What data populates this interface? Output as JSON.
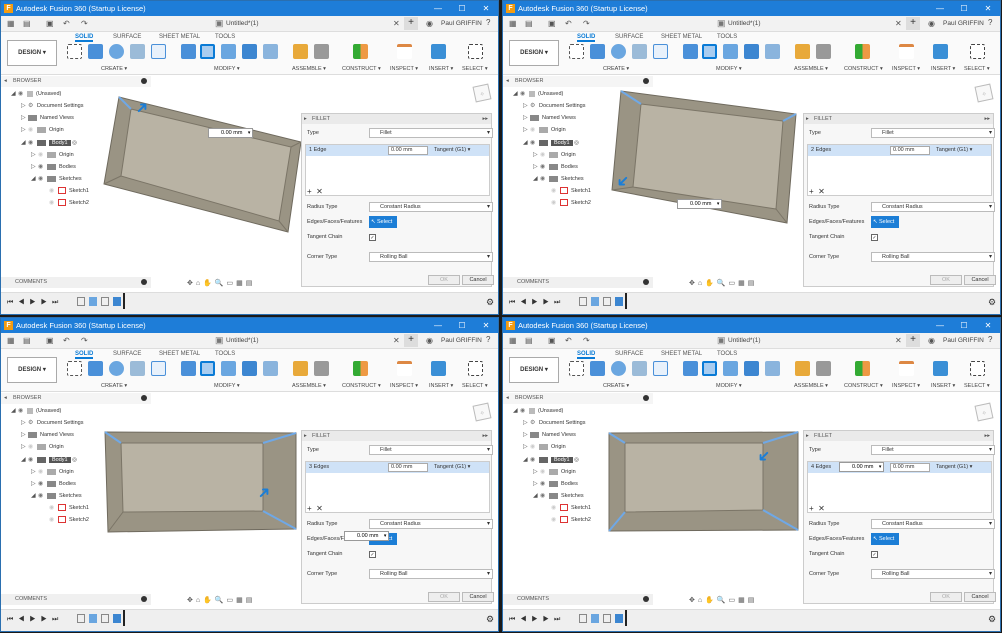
{
  "common": {
    "window_title": "Autodesk Fusion 360 (Startup License)",
    "doc_title": "Untitled*(1)",
    "user": "Paul GRIFFIN",
    "workspace": "DESIGN",
    "tabs": [
      "SOLID",
      "SURFACE",
      "SHEET METAL",
      "TOOLS"
    ],
    "groups": [
      "CREATE",
      "MODIFY",
      "ASSEMBLE",
      "CONSTRUCT",
      "INSPECT",
      "INSERT",
      "SELECT"
    ],
    "browser_label": "BROWSER",
    "comments_label": "COMMENTS",
    "tree": [
      "(Unsaved)",
      "Document Settings",
      "Named Views",
      "Origin",
      "Body1",
      "Origin",
      "Bodies",
      "Sketches",
      "Sketch1",
      "Sketch2"
    ],
    "fillet": {
      "header": "FILLET",
      "type_label": "Type",
      "type_value": "Fillet",
      "mm": "0.00 mm",
      "tangent": "Tangent (G1)",
      "radius_type_label": "Radius Type",
      "radius_type_value": "Constant Radius",
      "edges_label": "Edges/Faces/Features",
      "select_label": "Select",
      "tangent_chain_label": "Tangent Chain",
      "corner_type_label": "Corner Type",
      "corner_type_value": "Rolling Ball",
      "ok": "OK",
      "cancel": "Cancel"
    },
    "colors": {
      "titlebar": "#1e7dd8",
      "accent": "#0a7bd6",
      "selection": "#cfe2f7",
      "box_face": "#9a9484"
    }
  },
  "panels": [
    {
      "edges": "1 Edge",
      "float_mm": "0.00 mm"
    },
    {
      "edges": "2 Edges",
      "float_mm": "0.00 mm"
    },
    {
      "edges": "3 Edges",
      "float_mm": "0.00 mm"
    },
    {
      "edges": "4 Edges",
      "float_mm": "0.00 mm"
    }
  ]
}
